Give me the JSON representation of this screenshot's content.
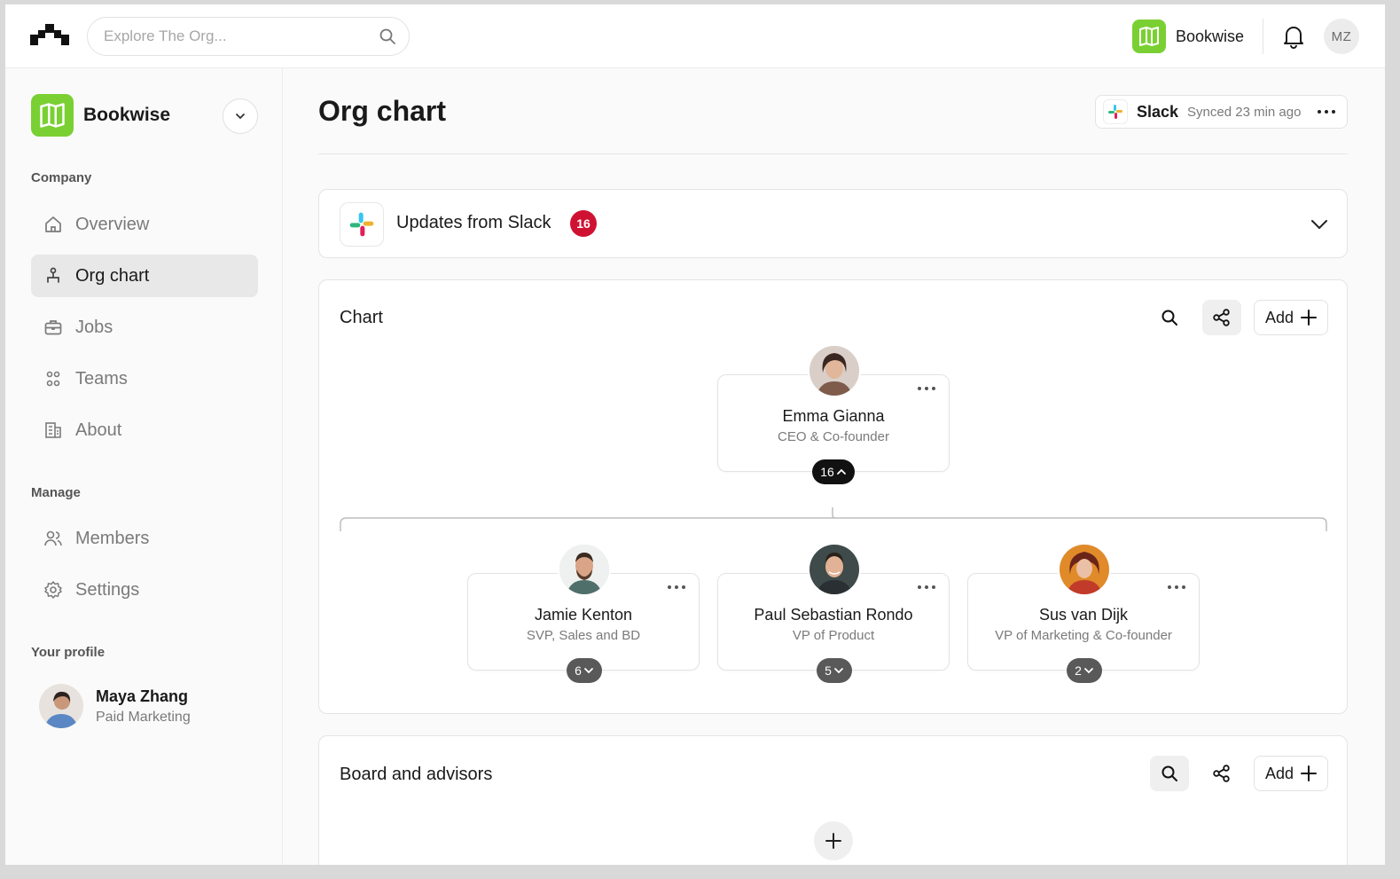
{
  "topbar": {
    "search_placeholder": "Explore The Org...",
    "org_name": "Bookwise",
    "user_initials": "MZ"
  },
  "sidebar": {
    "org_name": "Bookwise",
    "sections": {
      "company": "Company",
      "manage": "Manage",
      "profile": "Your profile"
    },
    "items": [
      {
        "label": "Overview",
        "icon": "home-icon"
      },
      {
        "label": "Org chart",
        "icon": "org-chart-icon",
        "active": true
      },
      {
        "label": "Jobs",
        "icon": "briefcase-icon"
      },
      {
        "label": "Teams",
        "icon": "teams-icon"
      },
      {
        "label": "About",
        "icon": "building-icon"
      },
      {
        "label": "Members",
        "icon": "members-icon"
      },
      {
        "label": "Settings",
        "icon": "gear-icon"
      }
    ],
    "profile": {
      "name": "Maya Zhang",
      "role": "Paid Marketing"
    }
  },
  "main": {
    "title": "Org chart",
    "sync": {
      "source": "Slack",
      "status": "Synced 23 min ago"
    },
    "updates": {
      "title": "Updates from Slack",
      "count": "16"
    },
    "chart": {
      "title": "Chart",
      "add_label": "Add",
      "root": {
        "name": "Emma Gianna",
        "role": "CEO & Co-founder",
        "reports": "16"
      },
      "children": [
        {
          "name": "Jamie Kenton",
          "role": "SVP, Sales and BD",
          "reports": "6"
        },
        {
          "name": "Paul Sebastian Rondo",
          "role": "VP of Product",
          "reports": "5"
        },
        {
          "name": "Sus van Dijk",
          "role": "VP of Marketing & Co-founder",
          "reports": "2"
        }
      ]
    },
    "board": {
      "title": "Board and advisors",
      "add_label": "Add"
    }
  },
  "colors": {
    "brand_green": "#7ad033",
    "badge_red": "#cf1232",
    "active_bg": "#e8e8e8"
  }
}
